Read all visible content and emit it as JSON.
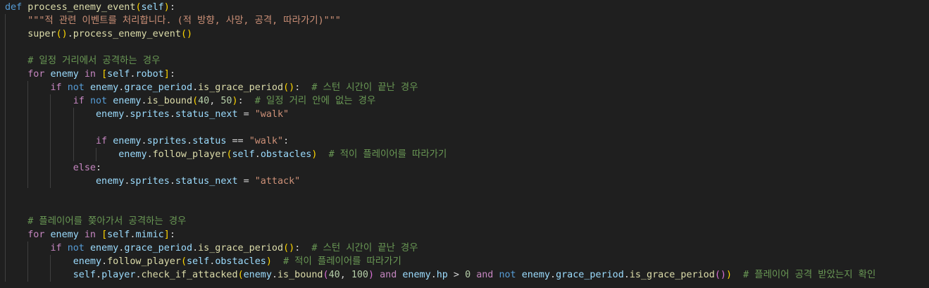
{
  "editor": {
    "language": "python",
    "theme_colors": {
      "background": "#1f1f1f",
      "keyword": "#569cd6",
      "control_keyword": "#c586c0",
      "function": "#dcdcaa",
      "variable": "#9cdcfe",
      "string": "#ce9178",
      "number": "#b5cea8",
      "comment": "#6a9955",
      "bracket_level_1": "#ffd700",
      "bracket_level_2": "#da70d6",
      "bracket_level_3": "#179fff"
    },
    "lines": [
      [
        [
          "kw",
          "def"
        ],
        [
          "p",
          " "
        ],
        [
          "fn",
          "process_enemy_event"
        ],
        [
          "b1",
          "("
        ],
        [
          "self",
          "self"
        ],
        [
          "b1",
          ")"
        ],
        [
          "p",
          ":"
        ]
      ],
      [
        [
          "p",
          "    "
        ],
        [
          "str",
          "\"\"\"적 관련 이벤트를 처리합니다. (적 방향, 사망, 공격, 따라가기)\"\"\""
        ]
      ],
      [
        [
          "p",
          "    "
        ],
        [
          "fn",
          "super"
        ],
        [
          "b1",
          "()"
        ],
        [
          "p",
          "."
        ],
        [
          "fn",
          "process_enemy_event"
        ],
        [
          "b1",
          "()"
        ]
      ],
      [],
      [
        [
          "p",
          "    "
        ],
        [
          "cmt",
          "# 일정 거리에서 공격하는 경우"
        ]
      ],
      [
        [
          "p",
          "    "
        ],
        [
          "kc",
          "for"
        ],
        [
          "p",
          " "
        ],
        [
          "var",
          "enemy"
        ],
        [
          "p",
          " "
        ],
        [
          "kc",
          "in"
        ],
        [
          "p",
          " "
        ],
        [
          "b1",
          "["
        ],
        [
          "self",
          "self"
        ],
        [
          "p",
          "."
        ],
        [
          "var",
          "robot"
        ],
        [
          "b1",
          "]"
        ],
        [
          "p",
          ":"
        ]
      ],
      [
        [
          "p",
          "        "
        ],
        [
          "kc",
          "if"
        ],
        [
          "p",
          " "
        ],
        [
          "kw",
          "not"
        ],
        [
          "p",
          " "
        ],
        [
          "var",
          "enemy"
        ],
        [
          "p",
          "."
        ],
        [
          "var",
          "grace_period"
        ],
        [
          "p",
          "."
        ],
        [
          "fn",
          "is_grace_period"
        ],
        [
          "b1",
          "()"
        ],
        [
          "p",
          ":  "
        ],
        [
          "cmt",
          "# 스턴 시간이 끝난 경우"
        ]
      ],
      [
        [
          "p",
          "            "
        ],
        [
          "kc",
          "if"
        ],
        [
          "p",
          " "
        ],
        [
          "kw",
          "not"
        ],
        [
          "p",
          " "
        ],
        [
          "var",
          "enemy"
        ],
        [
          "p",
          "."
        ],
        [
          "fn",
          "is_bound"
        ],
        [
          "b1",
          "("
        ],
        [
          "num",
          "40"
        ],
        [
          "p",
          ", "
        ],
        [
          "num",
          "50"
        ],
        [
          "b1",
          ")"
        ],
        [
          "p",
          ":  "
        ],
        [
          "cmt",
          "# 일정 거리 안에 없는 경우"
        ]
      ],
      [
        [
          "p",
          "                "
        ],
        [
          "var",
          "enemy"
        ],
        [
          "p",
          "."
        ],
        [
          "var",
          "sprites"
        ],
        [
          "p",
          "."
        ],
        [
          "var",
          "status_next"
        ],
        [
          "p",
          " = "
        ],
        [
          "str",
          "\"walk\""
        ]
      ],
      [],
      [
        [
          "p",
          "                "
        ],
        [
          "kc",
          "if"
        ],
        [
          "p",
          " "
        ],
        [
          "var",
          "enemy"
        ],
        [
          "p",
          "."
        ],
        [
          "var",
          "sprites"
        ],
        [
          "p",
          "."
        ],
        [
          "var",
          "status"
        ],
        [
          "p",
          " "
        ],
        [
          "op",
          "=="
        ],
        [
          "p",
          " "
        ],
        [
          "str",
          "\"walk\""
        ],
        [
          "p",
          ":"
        ]
      ],
      [
        [
          "p",
          "                    "
        ],
        [
          "var",
          "enemy"
        ],
        [
          "p",
          "."
        ],
        [
          "fn",
          "follow_player"
        ],
        [
          "b1",
          "("
        ],
        [
          "self",
          "self"
        ],
        [
          "p",
          "."
        ],
        [
          "var",
          "obstacles"
        ],
        [
          "b1",
          ")"
        ],
        [
          "p",
          "  "
        ],
        [
          "cmt",
          "# 적이 플레이어를 따라가기"
        ]
      ],
      [
        [
          "p",
          "            "
        ],
        [
          "kc",
          "else"
        ],
        [
          "p",
          ":"
        ]
      ],
      [
        [
          "p",
          "                "
        ],
        [
          "var",
          "enemy"
        ],
        [
          "p",
          "."
        ],
        [
          "var",
          "sprites"
        ],
        [
          "p",
          "."
        ],
        [
          "var",
          "status_next"
        ],
        [
          "p",
          " = "
        ],
        [
          "str",
          "\"attack\""
        ]
      ],
      [],
      [],
      [
        [
          "p",
          "    "
        ],
        [
          "cmt",
          "# 플레이어를 쫒아가서 공격하는 경우"
        ]
      ],
      [
        [
          "p",
          "    "
        ],
        [
          "kc",
          "for"
        ],
        [
          "p",
          " "
        ],
        [
          "var",
          "enemy"
        ],
        [
          "p",
          " "
        ],
        [
          "kc",
          "in"
        ],
        [
          "p",
          " "
        ],
        [
          "b1",
          "["
        ],
        [
          "self",
          "self"
        ],
        [
          "p",
          "."
        ],
        [
          "var",
          "mimic"
        ],
        [
          "b1",
          "]"
        ],
        [
          "p",
          ":"
        ]
      ],
      [
        [
          "p",
          "        "
        ],
        [
          "kc",
          "if"
        ],
        [
          "p",
          " "
        ],
        [
          "kw",
          "not"
        ],
        [
          "p",
          " "
        ],
        [
          "var",
          "enemy"
        ],
        [
          "p",
          "."
        ],
        [
          "var",
          "grace_period"
        ],
        [
          "p",
          "."
        ],
        [
          "fn",
          "is_grace_period"
        ],
        [
          "b1",
          "()"
        ],
        [
          "p",
          ":  "
        ],
        [
          "cmt",
          "# 스턴 시간이 끝난 경우"
        ]
      ],
      [
        [
          "p",
          "            "
        ],
        [
          "var",
          "enemy"
        ],
        [
          "p",
          "."
        ],
        [
          "fn",
          "follow_player"
        ],
        [
          "b1",
          "("
        ],
        [
          "self",
          "self"
        ],
        [
          "p",
          "."
        ],
        [
          "var",
          "obstacles"
        ],
        [
          "b1",
          ")"
        ],
        [
          "p",
          "  "
        ],
        [
          "cmt",
          "# 적이 플레이어를 따라가기"
        ]
      ],
      [
        [
          "p",
          "            "
        ],
        [
          "self",
          "self"
        ],
        [
          "p",
          "."
        ],
        [
          "var",
          "player"
        ],
        [
          "p",
          "."
        ],
        [
          "fn",
          "check_if_attacked"
        ],
        [
          "b1",
          "("
        ],
        [
          "var",
          "enemy"
        ],
        [
          "p",
          "."
        ],
        [
          "fn",
          "is_bound"
        ],
        [
          "b2",
          "("
        ],
        [
          "num",
          "40"
        ],
        [
          "p",
          ", "
        ],
        [
          "num",
          "100"
        ],
        [
          "b2",
          ")"
        ],
        [
          "p",
          " "
        ],
        [
          "kc",
          "and"
        ],
        [
          "p",
          " "
        ],
        [
          "var",
          "enemy"
        ],
        [
          "p",
          "."
        ],
        [
          "var",
          "hp"
        ],
        [
          "p",
          " > "
        ],
        [
          "num",
          "0"
        ],
        [
          "p",
          " "
        ],
        [
          "kc",
          "and"
        ],
        [
          "p",
          " "
        ],
        [
          "kw",
          "not"
        ],
        [
          "p",
          " "
        ],
        [
          "var",
          "enemy"
        ],
        [
          "p",
          "."
        ],
        [
          "var",
          "grace_period"
        ],
        [
          "p",
          "."
        ],
        [
          "fn",
          "is_grace_period"
        ],
        [
          "b2",
          "()"
        ],
        [
          "b1",
          ")"
        ],
        [
          "p",
          "  "
        ],
        [
          "cmt",
          "# 플레이어 공격 받았는지 확인"
        ]
      ]
    ]
  }
}
